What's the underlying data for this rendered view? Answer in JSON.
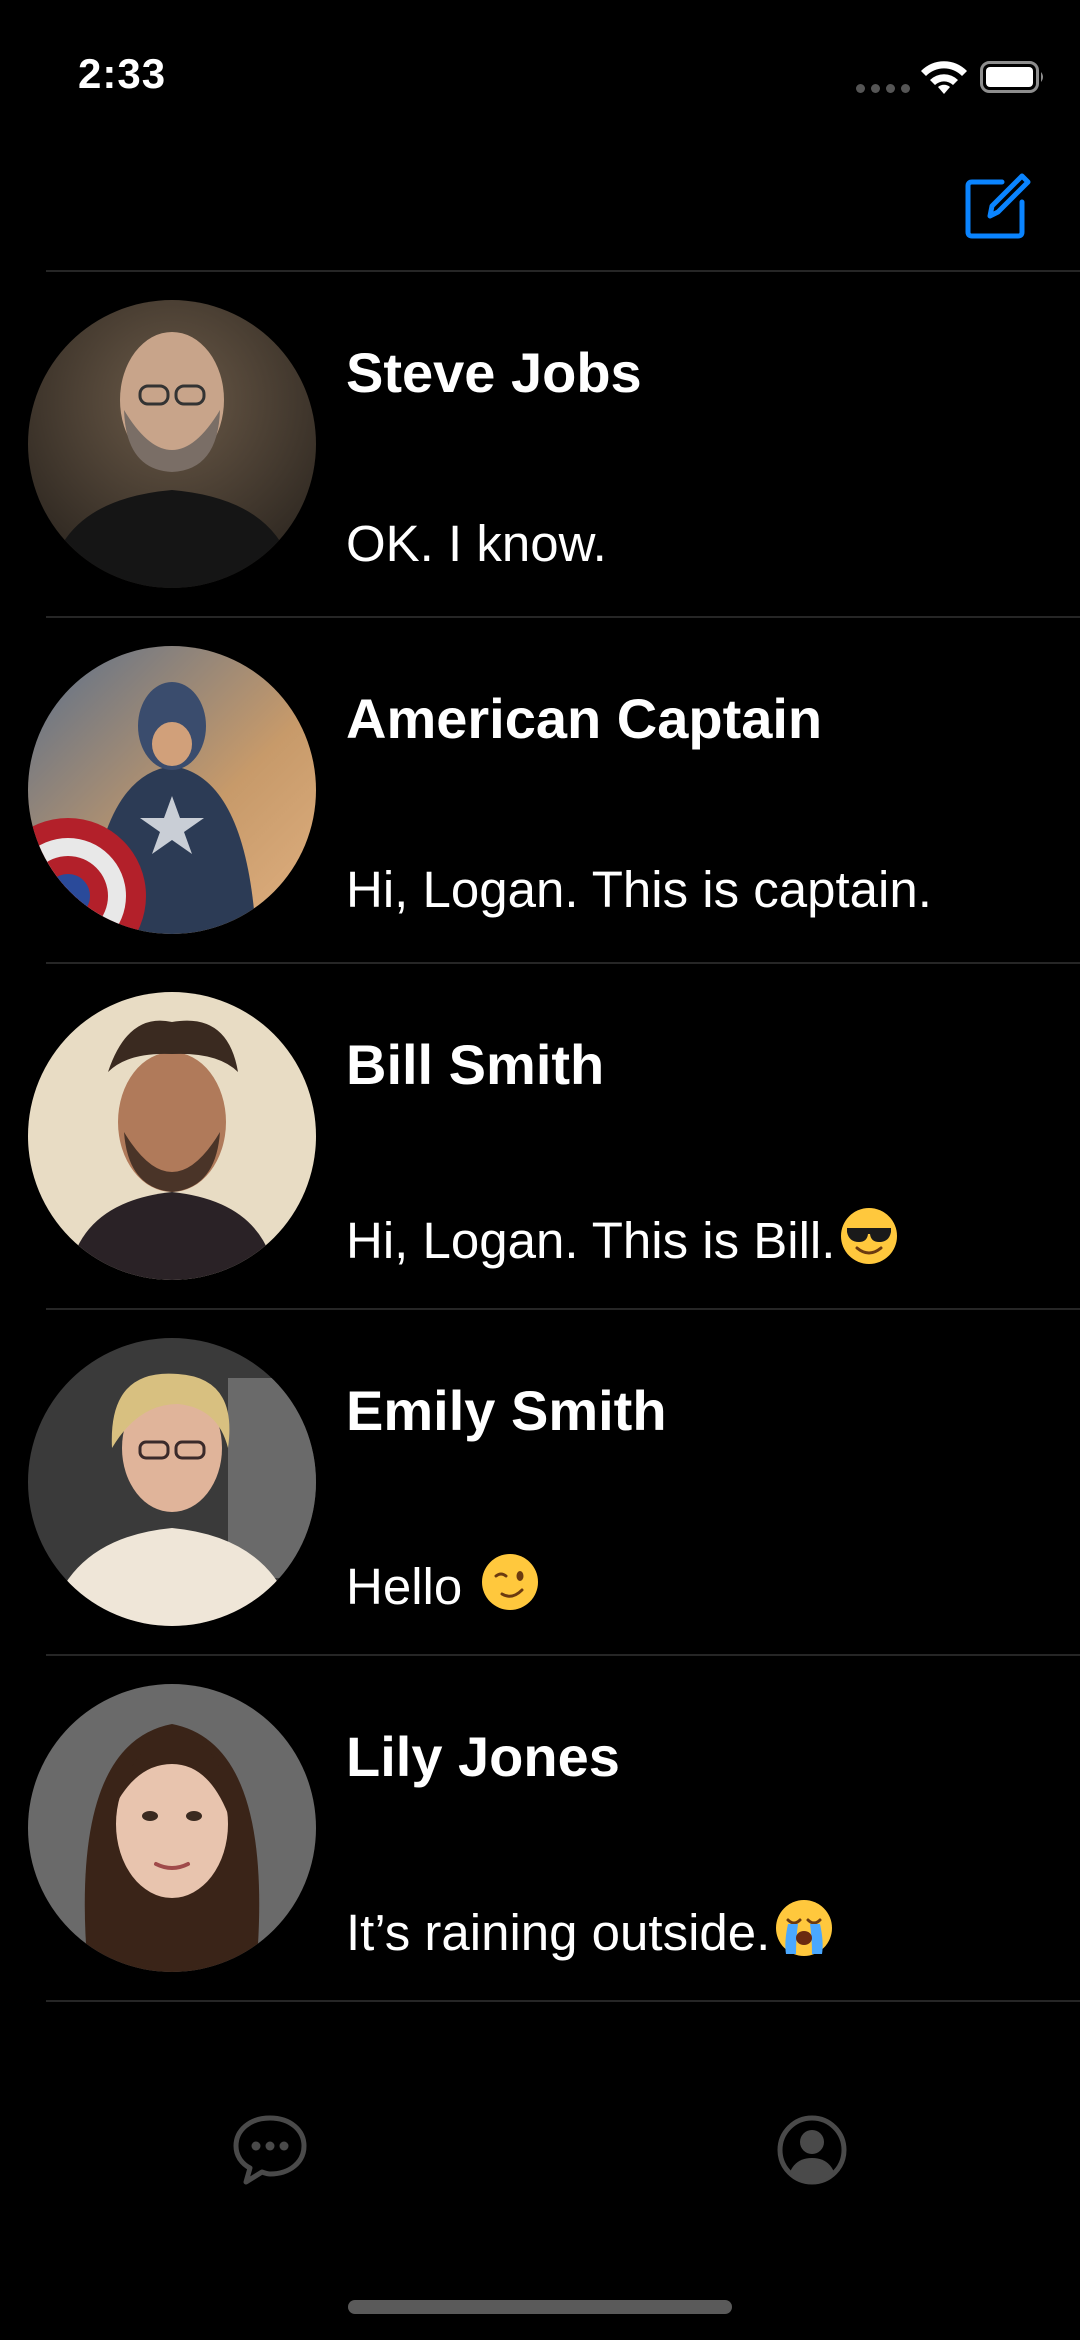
{
  "status_bar": {
    "time": "2:33"
  },
  "nav_bar": {
    "compose_icon": "compose-icon"
  },
  "chats": [
    {
      "name": "Steve Jobs",
      "message": "OK. I know.",
      "emoji": ""
    },
    {
      "name": "American Captain",
      "message": "Hi, Logan. This is captain.",
      "emoji": ""
    },
    {
      "name": "Bill Smith",
      "message": "Hi, Logan. This is Bill.",
      "emoji": "smiling-face-with-sunglasses"
    },
    {
      "name": "Emily Smith",
      "message": "Hello ",
      "emoji": "winking-face"
    },
    {
      "name": "Lily Jones",
      "message": "It’s raining outside.",
      "emoji": "loudly-crying-face"
    }
  ],
  "tab_bar": {
    "items": [
      {
        "icon": "chat-bubble-icon"
      },
      {
        "icon": "profile-icon"
      }
    ]
  },
  "colors": {
    "accent": "#0A84FF",
    "background": "#000000",
    "divider": "#262626",
    "tab_inactive": "#4a4a4a"
  }
}
